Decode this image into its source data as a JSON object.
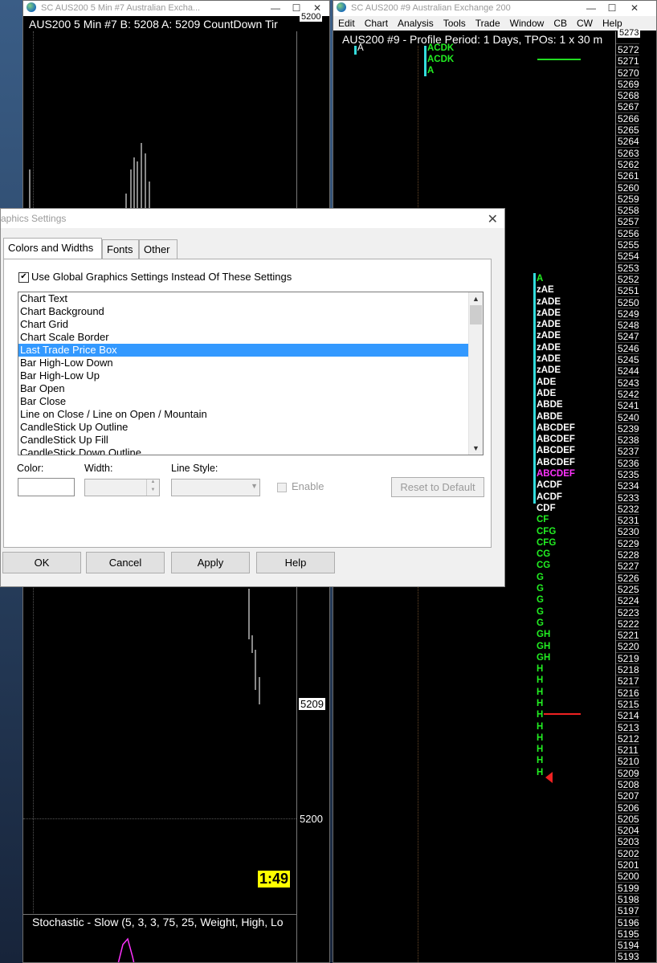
{
  "left_window": {
    "title": "SC AUS200  5 Min   #7  Australian Exchа...",
    "chart_header": "AUS200  5 Min   #7 B: 5208 A: 5209 CountDown Tir",
    "scale_top": "5200",
    "last_price": "5209",
    "scale_5200": "5200",
    "countdown": "1:49",
    "study": "Stochastic - Slow   (5, 3, 3, 75, 25, Weight, High, Lo"
  },
  "right_window": {
    "title": "SC AUS200  #9  Australian Exchange 200",
    "menu": [
      "Edit",
      "Chart",
      "Analysis",
      "Tools",
      "Trade",
      "Window",
      "CB",
      "CW",
      "Help"
    ],
    "chart_header": "AUS200  #9 - Profile Period: 1 Days, TPOs: 1 x 30 m",
    "top_letters": [
      "ACDK",
      "ACDK",
      "A"
    ],
    "small_letter": "A",
    "scale_top": "5273",
    "scale_first": 5272,
    "scale_last": 5193,
    "profile": [
      {
        "t": "A",
        "c": "#22ee22"
      },
      {
        "t": "zAE",
        "c": "#ffffff"
      },
      {
        "t": "zADE",
        "c": "#ffffff"
      },
      {
        "t": "zADE",
        "c": "#ffffff"
      },
      {
        "t": "zADE",
        "c": "#ffffff"
      },
      {
        "t": "zADE",
        "c": "#ffffff"
      },
      {
        "t": "zADE",
        "c": "#ffffff"
      },
      {
        "t": "zADE",
        "c": "#ffffff"
      },
      {
        "t": "zADE",
        "c": "#ffffff"
      },
      {
        "t": "ADE",
        "c": "#ffffff"
      },
      {
        "t": "ADE",
        "c": "#ffffff"
      },
      {
        "t": "ABDE",
        "c": "#ffffff"
      },
      {
        "t": "ABDE",
        "c": "#ffffff"
      },
      {
        "t": "ABCDEF",
        "c": "#ffffff"
      },
      {
        "t": "ABCDEF",
        "c": "#ffffff"
      },
      {
        "t": "ABCDEF",
        "c": "#ffffff"
      },
      {
        "t": "ABCDEF",
        "c": "#ffffff"
      },
      {
        "t": "ABCDEF",
        "c": "#ff33ff"
      },
      {
        "t": "ACDF",
        "c": "#ffffff"
      },
      {
        "t": "ACDF",
        "c": "#ffffff"
      },
      {
        "t": "CDF",
        "c": "#ffffff"
      },
      {
        "t": "CF",
        "c": "#22ee22"
      },
      {
        "t": "CFG",
        "c": "#22ee22"
      },
      {
        "t": "CFG",
        "c": "#22ee22"
      },
      {
        "t": "CG",
        "c": "#22ee22"
      },
      {
        "t": "CG",
        "c": "#22ee22"
      },
      {
        "t": "G",
        "c": "#22ee22"
      },
      {
        "t": "G",
        "c": "#22ee22"
      },
      {
        "t": "G",
        "c": "#22ee22"
      },
      {
        "t": "G",
        "c": "#22ee22"
      },
      {
        "t": "G",
        "c": "#22ee22"
      },
      {
        "t": "GH",
        "c": "#22ee22"
      },
      {
        "t": "GH",
        "c": "#22ee22"
      },
      {
        "t": "GH",
        "c": "#22ee22"
      },
      {
        "t": "H",
        "c": "#22ee22"
      },
      {
        "t": "H",
        "c": "#22ee22"
      },
      {
        "t": "H",
        "c": "#22ee22"
      },
      {
        "t": "H",
        "c": "#22ee22"
      },
      {
        "t": "H",
        "c": "#22ee22"
      },
      {
        "t": "H",
        "c": "#22ee22"
      },
      {
        "t": "H",
        "c": "#22ee22"
      },
      {
        "t": "H",
        "c": "#22ee22"
      },
      {
        "t": "H",
        "c": "#22ee22"
      },
      {
        "t": "H",
        "c": "#22ee22"
      }
    ]
  },
  "dialog": {
    "title": "aphics Settings",
    "tabs": [
      "Colors and Widths",
      "Fonts",
      "Other"
    ],
    "use_global_label": "Use Global Graphics Settings Instead Of These Settings",
    "use_global_checked": true,
    "list_items": [
      "Chart Text",
      "Chart Background",
      "Chart Grid",
      "Chart Scale Border",
      "Last Trade Price Box",
      "Bar High-Low Down",
      "Bar High-Low Up",
      "Bar Open",
      "Bar Close",
      "Line on Close / Line on Open / Mountain",
      "CandleStick Up Outline",
      "CandleStick Up Fill",
      "CandleStick Down Outline"
    ],
    "selected_index": 4,
    "color_label": "Color:",
    "width_label": "Width:",
    "line_style_label": "Line Style:",
    "enable_label": "Enable",
    "reset_label": "Reset to Default",
    "ok_label": "OK",
    "cancel_label": "Cancel",
    "apply_label": "Apply",
    "help_label": "Help"
  }
}
